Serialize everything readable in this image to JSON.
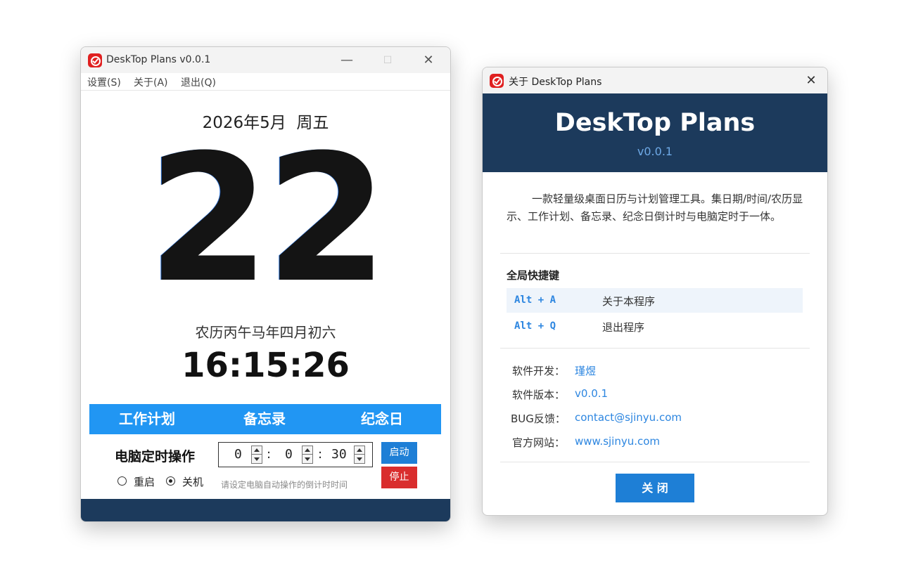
{
  "main_window": {
    "title": "DeskTop Plans v0.0.1",
    "controls": {
      "minimize": "—",
      "maximize": "☐",
      "close": "✕"
    },
    "menu": [
      "设置(S)",
      "关于(A)",
      "退出(Q)"
    ],
    "date_line": "2026年5月  周五",
    "day": "22",
    "lunar": "农历丙午马年四月初六",
    "clock": "16:15:26",
    "tabs": [
      "工作计划",
      "备忘录",
      "纪念日"
    ],
    "shutdown": {
      "title": "电脑定时操作",
      "hours": "0",
      "minutes": "0",
      "seconds": "30",
      "separator": ":",
      "start_label": "启动",
      "stop_label": "停止",
      "options": [
        {
          "label": "重启",
          "selected": false
        },
        {
          "label": "关机",
          "selected": true
        }
      ],
      "hint": "请设定电脑自动操作的倒计时时间"
    }
  },
  "about_window": {
    "title": "关于 DeskTop Plans",
    "close_glyph": "✕",
    "app_name": "DeskTop Plans",
    "version": "v0.0.1",
    "description": "一款轻量级桌面日历与计划管理工具。集日期/时间/农历显示、工作计划、备忘录、纪念日倒计时与电脑定时于一体。",
    "shortcuts_title": "全局快捷键",
    "shortcuts": [
      {
        "keys": "Alt + A",
        "action": "关于本程序"
      },
      {
        "keys": "Alt + Q",
        "action": "退出程序"
      }
    ],
    "info": [
      {
        "label": "软件开发：",
        "value": "瑾煜"
      },
      {
        "label": "软件版本：",
        "value": "v0.0.1"
      },
      {
        "label": "BUG反馈：",
        "value": "contact@sjinyu.com"
      },
      {
        "label": "官方网站：",
        "value": "www.sjinyu.com"
      }
    ],
    "close_button": "关 闭"
  },
  "colors": {
    "accent_blue": "#2196f3",
    "button_blue": "#1e7fd6",
    "stop_red": "#d92d2d",
    "navy": "#1c3a5c",
    "link_blue": "#2d86e0"
  },
  "icons": [
    "app-clock-icon",
    "radio-icon",
    "spinner-icon"
  ]
}
